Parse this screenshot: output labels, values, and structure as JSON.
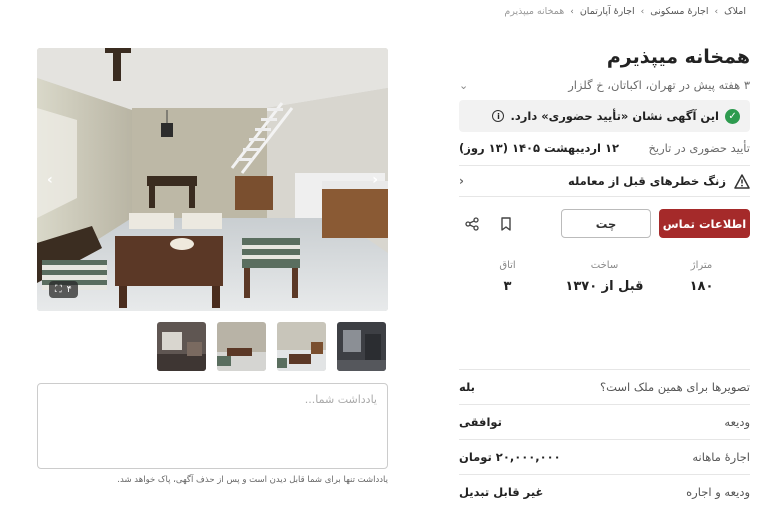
{
  "breadcrumb": [
    "املاک",
    "اجارهٔ مسکونی",
    "اجارهٔ آپارتمان",
    "همخانه میپذیرم"
  ],
  "listing": {
    "title": "همخانه میپذیرم",
    "subtitle": "۳ هفته پیش در تهران، اکباتان، خ گلزار",
    "verified_text": "این آگهی نشان «تأیید حضوری» دارد.",
    "verified_date_label": "تأیید حضوری در تاریخ",
    "verified_date_value": "۱۲ اردیبهشت ۱۴۰۵ (۱۳ روز)",
    "warning_text": "زنگ خطرهای قبل از معامله"
  },
  "actions": {
    "contact_label": "اطلاعات تماس",
    "chat_label": "چت"
  },
  "specs": [
    {
      "key": "متراژ",
      "value": "۱۸۰"
    },
    {
      "key": "ساخت",
      "value": "قبل از ۱۳۷۰"
    },
    {
      "key": "اتاق",
      "value": "۳"
    }
  ],
  "details": [
    {
      "key": "تصویرها برای همین ملک است؟",
      "value": "بله"
    },
    {
      "key": "ودیعه",
      "value": "توافقی"
    },
    {
      "key": "اجارهٔ ماهانه",
      "value": "۲۰,۰۰۰,۰۰۰ تومان"
    },
    {
      "key": "ودیعه و اجاره",
      "value": "غیر قابل تبدیل"
    }
  ],
  "gallery": {
    "count": "۴"
  },
  "note": {
    "placeholder": "یادداشت شما...",
    "hint": "یادداشت تنها برای شما قابل دیدن است و پس از حذف آگهی، پاک خواهد شد."
  },
  "colors": {
    "accent": "#a52a2a",
    "verified": "#2e9b4f"
  }
}
